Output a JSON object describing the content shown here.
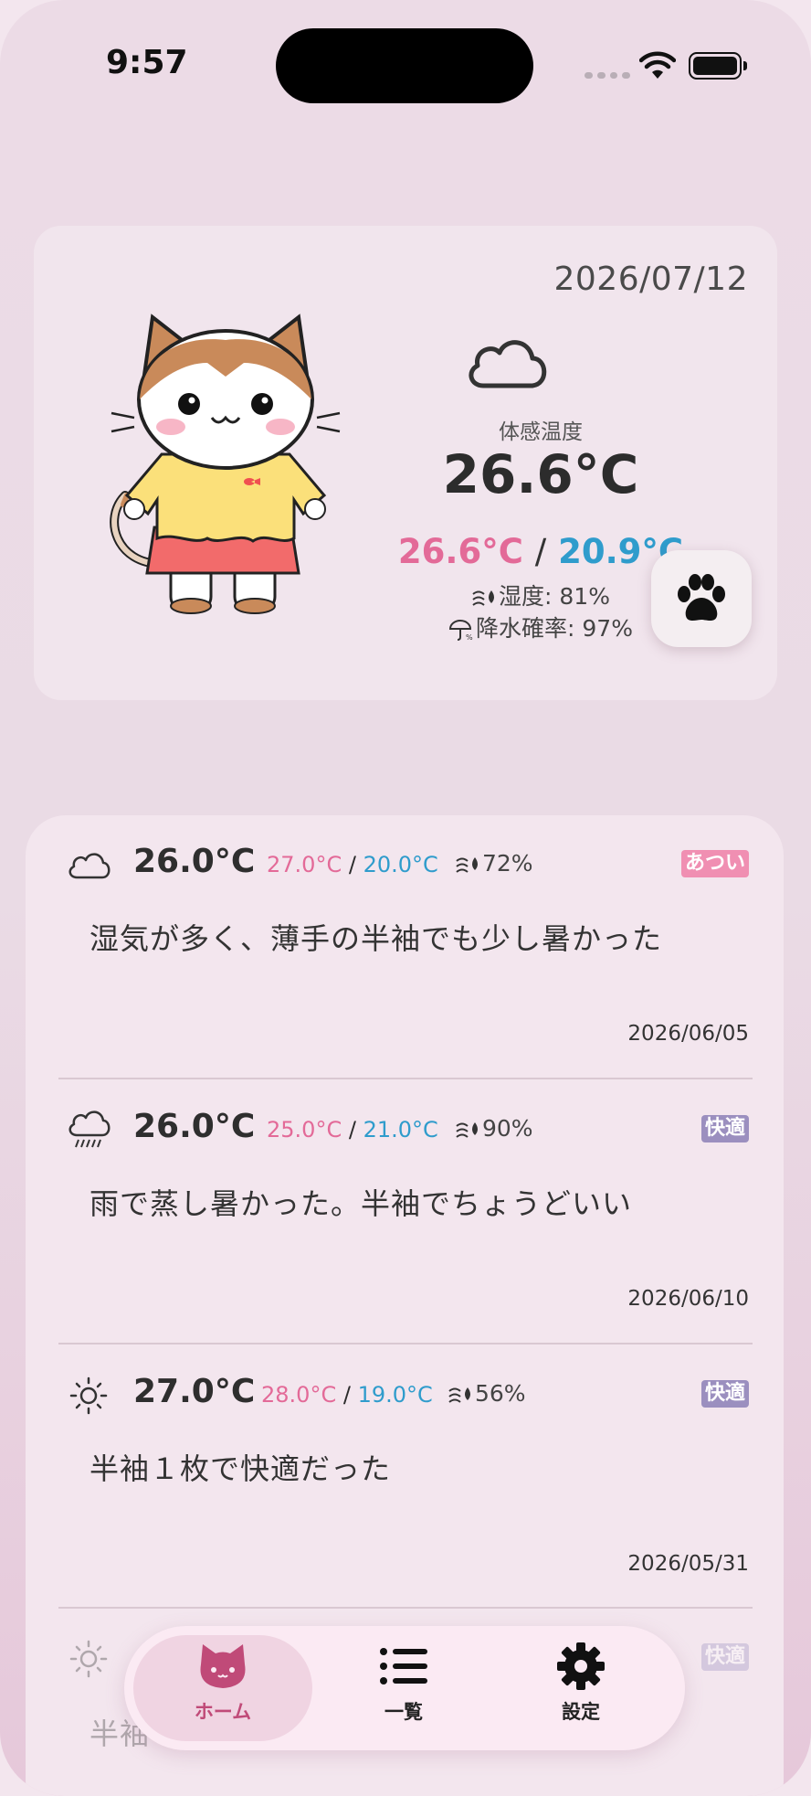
{
  "status_bar": {
    "time": "9:57"
  },
  "today": {
    "date": "2026/07/12",
    "weather_icon": "cloud-icon",
    "feels_like_label": "体感温度",
    "feels_like": "26.6°C",
    "high": "26.6°C",
    "low": "20.9°C",
    "sep": "/",
    "humidity": "湿度: 81%",
    "rain_chance": "降水確率: 97%"
  },
  "entries": [
    {
      "icon": "cloud-icon",
      "temp": "26.0°C",
      "high": "27.0°C",
      "low": "20.0°C",
      "sep": "/",
      "humidity": "72%",
      "badge": "あつい",
      "note": "湿気が多く、薄手の半袖でも少し暑かった",
      "date": "2026/06/05"
    },
    {
      "icon": "rain-cloud-icon",
      "temp": "26.0°C",
      "high": "25.0°C",
      "low": "21.0°C",
      "sep": "/",
      "humidity": "90%",
      "badge": "快適",
      "note": "雨で蒸し暑かった。半袖でちょうどいい",
      "date": "2026/06/10"
    },
    {
      "icon": "sun-icon",
      "temp": "27.0°C",
      "high": "28.0°C",
      "low": "19.0°C",
      "sep": "/",
      "humidity": "56%",
      "badge": "快適",
      "note": "半袖１枚で快適だった",
      "date": "2026/05/31"
    },
    {
      "icon": "sun-icon",
      "badge": "快適",
      "note_partial": "半袖"
    }
  ],
  "tabbar": {
    "home": "ホーム",
    "list": "一覧",
    "settings": "設定"
  },
  "colors": {
    "high": "#e36a98",
    "low": "#2f9ccc",
    "badge_hot": "#f08fb2",
    "badge_ok": "#9b8fbf",
    "active_tab": "#c04a78"
  }
}
